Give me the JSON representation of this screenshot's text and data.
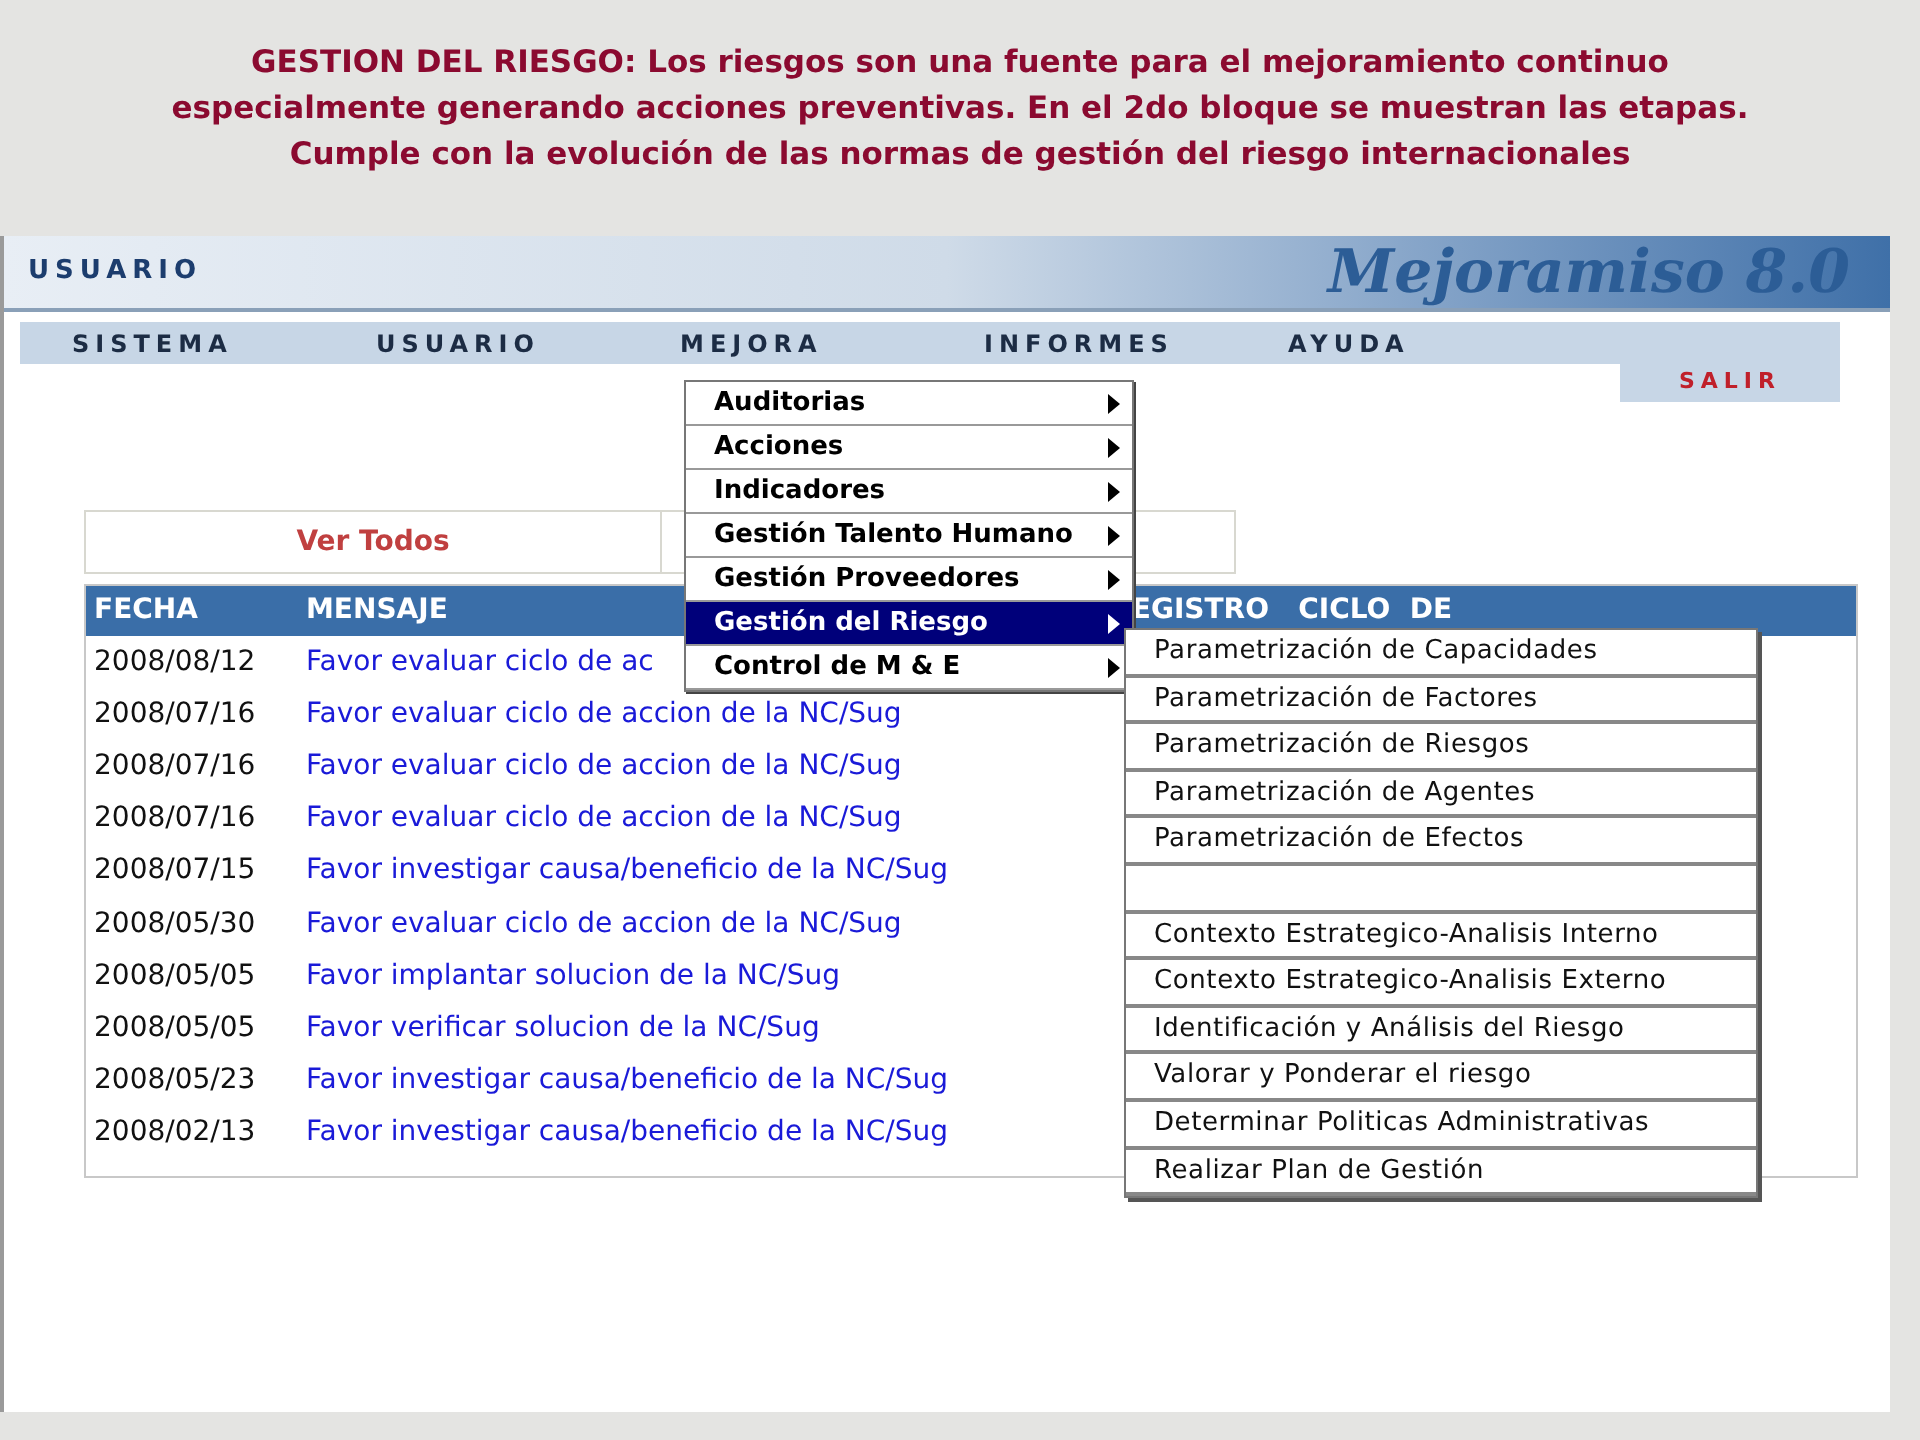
{
  "slide_title": "GESTION DEL RIESGO: Los riesgos son una fuente para el mejoramiento continuo especialmente generando acciones preventivas. En el 2do bloque se muestran las etapas. Cumple con la evolución de las normas de gestión del riesgo internacionales",
  "header": {
    "user_label": "USUARIO",
    "logo": "Mejoramiso 8.0"
  },
  "menu_bar": [
    {
      "label": "SISTEMA"
    },
    {
      "label": "USUARIO"
    },
    {
      "label": "MEJORA"
    },
    {
      "label": "INFORMES"
    },
    {
      "label": "AYUDA"
    }
  ],
  "exit_button": "SALIR",
  "view_all_link": "Ver Todos",
  "table": {
    "columns": [
      "FECHA",
      "MENSAJE",
      "EGISTRO   CICLO  DE"
    ],
    "rows": [
      {
        "fecha": "2008/08/12",
        "mensaje": "Favor evaluar ciclo de ac"
      },
      {
        "fecha": "2008/07/16",
        "mensaje": "Favor evaluar ciclo de accion de la NC/Sug"
      },
      {
        "fecha": "2008/07/16",
        "mensaje": "Favor evaluar ciclo de accion de la NC/Sug"
      },
      {
        "fecha": "2008/07/16",
        "mensaje": "Favor evaluar ciclo de accion de la NC/Sug"
      },
      {
        "fecha": "2008/07/15",
        "mensaje": "Favor investigar causa/beneficio de la NC/Sug"
      },
      {
        "fecha": "2008/05/30",
        "mensaje": "Favor evaluar ciclo de accion de la NC/Sug"
      },
      {
        "fecha": "2008/05/05",
        "mensaje": "Favor implantar solucion de la NC/Sug"
      },
      {
        "fecha": "2008/05/05",
        "mensaje": "Favor verificar solucion de la NC/Sug"
      },
      {
        "fecha": "2008/05/23",
        "mensaje": "Favor investigar causa/beneficio de la NC/Sug"
      },
      {
        "fecha": "2008/02/13",
        "mensaje": "Favor investigar causa/beneficio de la NC/Sug"
      }
    ]
  },
  "dropdown_menu": [
    {
      "label": "Auditorias",
      "selected": false
    },
    {
      "label": "Acciones",
      "selected": false
    },
    {
      "label": "Indicadores",
      "selected": false
    },
    {
      "label": "Gestión Talento Humano",
      "selected": false
    },
    {
      "label": "Gestión Proveedores",
      "selected": false
    },
    {
      "label": "Gestión del Riesgo",
      "selected": true
    },
    {
      "label": "Control de M & E",
      "selected": false
    }
  ],
  "submenu": [
    {
      "kind": "item",
      "label": "Parametrización de Capacidades"
    },
    {
      "kind": "item",
      "label": "Parametrización de Factores"
    },
    {
      "kind": "item",
      "label": "Parametrización de Riesgos"
    },
    {
      "kind": "item",
      "label": "Parametrización de Agentes"
    },
    {
      "kind": "item",
      "label": "Parametrización de Efectos"
    },
    {
      "kind": "separator"
    },
    {
      "kind": "item",
      "label": "Contexto Estrategico-Analisis Interno"
    },
    {
      "kind": "item",
      "label": "Contexto Estrategico-Analisis Externo"
    },
    {
      "kind": "item",
      "label": "Identificación y Análisis del Riesgo"
    },
    {
      "kind": "item",
      "label": "Valorar y Ponderar el riesgo"
    },
    {
      "kind": "item",
      "label": "Determinar Politicas Administrativas"
    },
    {
      "kind": "item",
      "label": "Realizar Plan de Gestión"
    }
  ]
}
